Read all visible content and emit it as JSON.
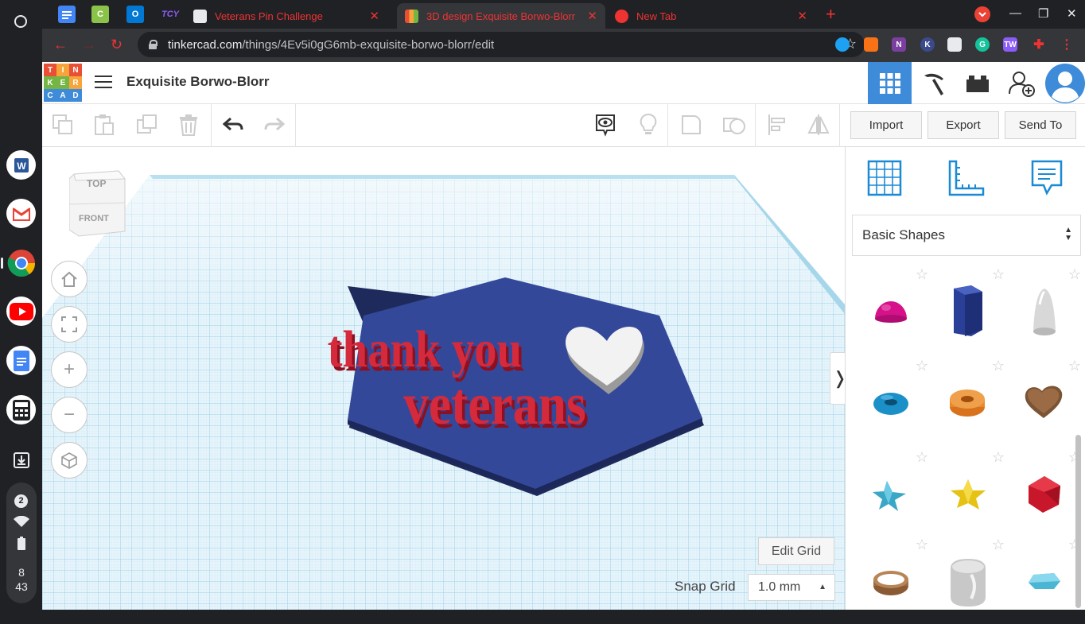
{
  "browser": {
    "tabs": [
      {
        "title": "Veterans Pin Challenge",
        "active": false
      },
      {
        "title": "3D design Exquisite Borwo-Blorr",
        "active": true
      },
      {
        "title": "New Tab",
        "active": false
      }
    ],
    "url_host": "tinkercad.com",
    "url_path": "/things/4Ev5i0gG6mb-exquisite-borwo-blorr/edit",
    "pinned_tab_label": "TCY",
    "extension_labels": [
      "N",
      "K",
      "G",
      "TW"
    ]
  },
  "system": {
    "notification_count": "2",
    "time_hour": "8",
    "time_minute": "43"
  },
  "app": {
    "logo_letters": [
      "T",
      "I",
      "N",
      "K",
      "E",
      "R",
      "C",
      "A",
      "D"
    ],
    "design_title": "Exquisite Borwo-Blorr",
    "toolbar": {
      "import_label": "Import",
      "export_label": "Export",
      "send_to_label": "Send To"
    },
    "viewcube": {
      "top_label": "TOP",
      "front_label": "FRONT"
    },
    "scene_text": {
      "line1": "thank you",
      "line2": "veterans"
    },
    "edit_grid_label": "Edit Grid",
    "snap_grid_label": "Snap Grid",
    "snap_grid_value": "1.0 mm",
    "shapes_category": "Basic Shapes"
  },
  "colors": {
    "tc_blue": "#3d8bd9",
    "hexagon": "#34489a",
    "text_red": "#d42a3c",
    "grid_line": "#9ccfe6",
    "tab_text": "#ee3333"
  }
}
